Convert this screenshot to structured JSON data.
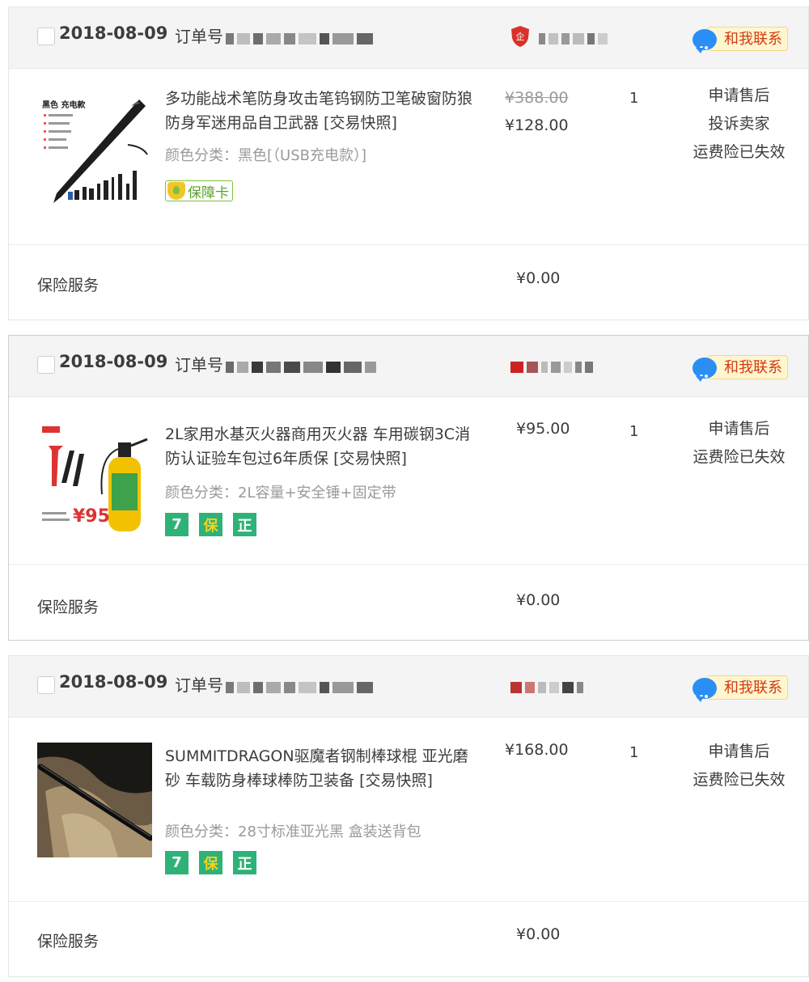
{
  "colors": {
    "price_strike": "#9a9a9a",
    "contact_text": "#d33a10",
    "badge_green": "#2eb277",
    "header_bg": "#f4f4f4"
  },
  "orders": [
    {
      "date": "2018-08-09",
      "order_no_label": "订单号",
      "contact_label": "和我联系",
      "shop_icon": "enterprise-shield-icon",
      "item": {
        "title": "多功能战术笔防身攻击笔钨钢防卫笔破窗防狼防身军迷用品自卫武器 [交易快照]",
        "variant": "颜色分类：黑色[（USB充电款）]",
        "original_price": "¥388.00",
        "price": "¥128.00",
        "quantity": "1",
        "actions": [
          "申请售后",
          "投诉卖家",
          "运费险已失效"
        ],
        "guarantee_label": "保障卡",
        "thumb_text": "黑色 充电款"
      },
      "insurance": {
        "label": "保险服务",
        "price": "¥0.00"
      }
    },
    {
      "date": "2018-08-09",
      "order_no_label": "订单号",
      "contact_label": "和我联系",
      "item": {
        "title": "2L家用水基灭火器商用灭火器 车用碳钢3C消防认证验车包过6年质保 [交易快照]",
        "variant": "颜色分类：2L容量+安全锤+固定带",
        "price": "¥95.00",
        "quantity": "1",
        "actions": [
          "申请售后",
          "运费险已失效"
        ],
        "badges": [
          "7",
          "保",
          "正"
        ],
        "thumb_text": "¥95"
      },
      "insurance": {
        "label": "保险服务",
        "price": "¥0.00"
      }
    },
    {
      "date": "2018-08-09",
      "order_no_label": "订单号",
      "contact_label": "和我联系",
      "item": {
        "title": "SUMMITDRAGON驱魔者钢制棒球棍 亚光磨砂 车载防身棒球棒防卫装备 [交易快照]",
        "variant": "颜色分类：28寸标准亚光黑 盒装送背包",
        "price": "¥168.00",
        "quantity": "1",
        "actions": [
          "申请售后",
          "运费险已失效"
        ],
        "badges": [
          "7",
          "保",
          "正"
        ]
      },
      "insurance": {
        "label": "保险服务",
        "price": "¥0.00"
      }
    }
  ]
}
